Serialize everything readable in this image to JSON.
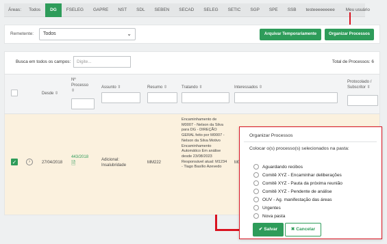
{
  "areas": {
    "label": "Áreas:",
    "tabs": [
      "Todos",
      "DG",
      "FSELEG",
      "GAPRE",
      "NST",
      "SDL",
      "SEBEN",
      "SECAD",
      "SELEG",
      "SETIC",
      "SGP",
      "SPE",
      "SSB",
      "testeeeeeeeee",
      "Meu usuário"
    ],
    "active": "DG"
  },
  "toolbar": {
    "remetente_label": "Remetente:",
    "remetente_value": "Todos",
    "archive_label": "Arquivar Temporariamente",
    "organize_label": "Organizar Processos"
  },
  "search": {
    "label": "Busca em todos os campos:",
    "placeholder": "Digite..."
  },
  "total": "Total de Processos: 6",
  "columns": {
    "desde": "Desde ⇳",
    "n_processo": "Nº Processo ⇳",
    "assunto": "Assunto ⇳",
    "resumo": "Resumo ⇳",
    "tratando": "Tratando ⇳",
    "interessados": "Interessados ⇳",
    "protocolado": "Protocolado / Subscritor ⇳"
  },
  "row": {
    "desde": "27/04/2018",
    "n_processo": "443/2018",
    "assunto": "Adicional: Insalubridade",
    "resumo": "MM222",
    "tratando": "Encaminhamento de M0007 - Nelson da Silva para DG - DIREÇÃO GERAL feito por M0007 - Nelson da Silva Motivo Encaminhamento Automático Em análise desde 23/08/2023 Responsável atual: M1234 - Tiago Basílio Azevedo",
    "interessados": "M00"
  },
  "modal": {
    "title": "Organizar Processos",
    "subtitle": "Colocar o(s) processo(s) selecionados na pasta:",
    "options": [
      "Aguardando recibos",
      "Comitê XYZ - Encaminhar deliberações",
      "Comitê XYZ - Pauta da próxima reunião",
      "Comitê XYZ - Pendente de análise",
      "OUV - Ag. manifestação das áreas",
      "Urgentes",
      "Nova pasta"
    ],
    "save_label": "Salvar",
    "cancel_label": "Cancelar"
  },
  "colors": {
    "accent": "#2e9c5a",
    "highlight": "#d9121f",
    "row_selected": "#fbf1de"
  }
}
